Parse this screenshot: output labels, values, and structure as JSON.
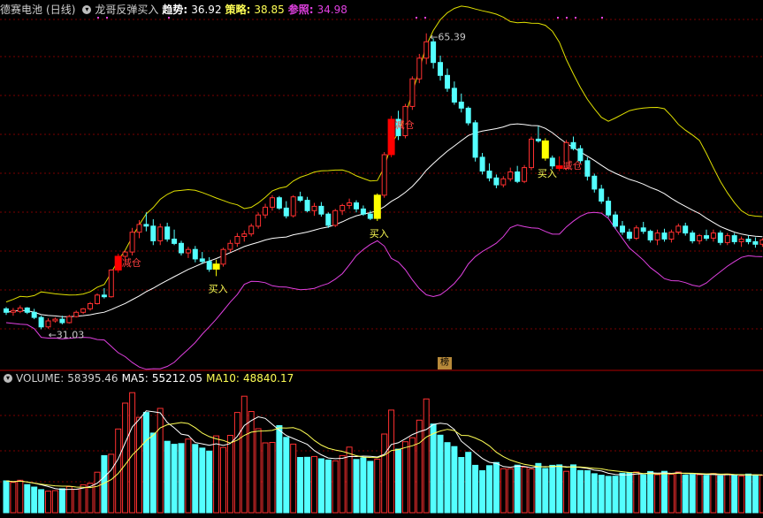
{
  "header": {
    "stock_name": "德赛电池",
    "period": "(日线)",
    "indicator_name": "龙哥反弹买入",
    "trend_label": "趋势:",
    "trend_value": "36.92",
    "strategy_label": "策略:",
    "strategy_value": "38.85",
    "ref_label": "参照:",
    "ref_value": "34.98"
  },
  "volume_header": {
    "vol_label": "VOLUME:",
    "vol_value": "58395.46",
    "ma5_label": "MA5:",
    "ma5_value": "55212.05",
    "ma10_label": "MA10:",
    "ma10_value": "48840.17"
  },
  "divider_tag": "榜",
  "colors": {
    "background": "#000000",
    "up": "#ff3030",
    "down": "#54ffff",
    "upper_band": "#e0e000",
    "mid_line": "#ffffff",
    "lower_band": "#e040e0",
    "grid": "#7a0000",
    "buy_bar": "#ffff00",
    "sell_bar": "#ff0000"
  },
  "chart_data": {
    "type": "candlestick",
    "price_min": 31.03,
    "price_max": 65.39,
    "labels": {
      "low": "31.03",
      "high": "65.39"
    },
    "signals": {
      "buy_text": "买入",
      "sell_text": "减仓",
      "buy_indices": [
        30,
        53,
        77
      ],
      "sell_indices": [
        16,
        55,
        79
      ]
    },
    "candles": [
      [
        33.4,
        33.6,
        32.7,
        33.0
      ],
      [
        33.0,
        33.5,
        32.6,
        33.2
      ],
      [
        33.1,
        33.8,
        32.9,
        33.5
      ],
      [
        33.5,
        33.6,
        32.8,
        33.0
      ],
      [
        33.0,
        33.4,
        32.2,
        32.4
      ],
      [
        32.4,
        32.6,
        31.03,
        31.3
      ],
      [
        31.3,
        32.3,
        31.1,
        32.0
      ],
      [
        32.0,
        32.4,
        31.8,
        32.2
      ],
      [
        32.2,
        32.6,
        31.6,
        31.8
      ],
      [
        31.8,
        32.7,
        31.7,
        32.5
      ],
      [
        32.5,
        33.2,
        32.4,
        33.0
      ],
      [
        33.0,
        33.5,
        32.8,
        33.4
      ],
      [
        33.4,
        34.2,
        33.2,
        34.0
      ],
      [
        34.0,
        35.2,
        33.9,
        35.0
      ],
      [
        35.0,
        35.8,
        34.6,
        34.8
      ],
      [
        34.8,
        38.0,
        34.7,
        37.9
      ],
      [
        37.9,
        39.8,
        37.6,
        39.5
      ],
      [
        39.5,
        40.2,
        38.9,
        40.0
      ],
      [
        40.0,
        42.8,
        39.6,
        42.3
      ],
      [
        42.3,
        43.7,
        41.6,
        43.2
      ],
      [
        43.2,
        44.6,
        42.4,
        43.0
      ],
      [
        43.0,
        43.8,
        40.8,
        41.3
      ],
      [
        41.3,
        43.3,
        40.8,
        42.9
      ],
      [
        42.9,
        43.4,
        41.2,
        41.5
      ],
      [
        41.5,
        42.6,
        40.8,
        41.0
      ],
      [
        41.0,
        41.3,
        39.6,
        39.9
      ],
      [
        39.9,
        40.6,
        39.3,
        40.3
      ],
      [
        40.3,
        40.7,
        38.8,
        39.2
      ],
      [
        39.2,
        40.0,
        38.6,
        38.9
      ],
      [
        38.9,
        39.4,
        37.7,
        38.0
      ],
      [
        38.0,
        39.1,
        37.2,
        38.6
      ],
      [
        38.6,
        40.5,
        38.3,
        40.3
      ],
      [
        40.3,
        41.4,
        40.0,
        41.0
      ],
      [
        41.0,
        42.2,
        40.6,
        41.8
      ],
      [
        41.8,
        42.5,
        41.2,
        42.1
      ],
      [
        42.1,
        43.3,
        41.8,
        43.0
      ],
      [
        43.0,
        44.6,
        42.7,
        44.3
      ],
      [
        44.3,
        45.6,
        43.9,
        45.2
      ],
      [
        45.2,
        46.6,
        44.8,
        46.3
      ],
      [
        46.3,
        46.5,
        44.9,
        45.1
      ],
      [
        45.1,
        45.9,
        43.9,
        44.2
      ],
      [
        44.2,
        46.6,
        44.0,
        46.4
      ],
      [
        46.4,
        47.0,
        45.8,
        46.0
      ],
      [
        46.0,
        46.4,
        44.6,
        44.8
      ],
      [
        44.8,
        45.7,
        44.2,
        45.3
      ],
      [
        45.3,
        45.8,
        44.1,
        44.4
      ],
      [
        44.4,
        44.6,
        42.8,
        43.1
      ],
      [
        43.1,
        45.0,
        42.9,
        44.8
      ],
      [
        44.8,
        45.6,
        44.3,
        45.4
      ],
      [
        45.4,
        46.2,
        45.0,
        45.7
      ],
      [
        45.7,
        46.0,
        44.6,
        45.0
      ],
      [
        45.0,
        45.4,
        44.2,
        44.4
      ],
      [
        44.4,
        44.8,
        43.7,
        43.9
      ],
      [
        43.9,
        46.8,
        43.6,
        46.6
      ],
      [
        46.6,
        51.6,
        46.3,
        51.3
      ],
      [
        51.3,
        55.8,
        51.0,
        55.4
      ],
      [
        55.4,
        56.4,
        53.0,
        53.5
      ],
      [
        53.5,
        57.2,
        53.2,
        56.9
      ],
      [
        56.9,
        60.4,
        56.5,
        60.1
      ],
      [
        60.1,
        63.0,
        59.6,
        62.5
      ],
      [
        62.5,
        65.39,
        61.8,
        64.4
      ],
      [
        64.4,
        64.8,
        61.3,
        62.0
      ],
      [
        62.0,
        62.8,
        59.9,
        60.5
      ],
      [
        60.5,
        61.3,
        58.6,
        59.0
      ],
      [
        59.0,
        59.8,
        57.1,
        57.4
      ],
      [
        57.4,
        58.4,
        56.2,
        56.7
      ],
      [
        56.7,
        56.9,
        54.7,
        55.0
      ],
      [
        55.0,
        55.3,
        50.5,
        51.0
      ],
      [
        51.0,
        51.5,
        49.0,
        49.4
      ],
      [
        49.4,
        50.3,
        48.2,
        48.6
      ],
      [
        48.6,
        49.0,
        47.4,
        47.8
      ],
      [
        47.8,
        48.8,
        47.5,
        48.5
      ],
      [
        48.5,
        49.8,
        48.2,
        49.3
      ],
      [
        49.3,
        50.0,
        48.0,
        48.2
      ],
      [
        48.2,
        50.1,
        48.0,
        49.8
      ],
      [
        49.8,
        53.4,
        49.5,
        53.1
      ],
      [
        53.1,
        54.6,
        52.7,
        52.9
      ],
      [
        52.9,
        53.2,
        50.6,
        50.9
      ],
      [
        50.9,
        51.2,
        49.6,
        50.0
      ],
      [
        50.0,
        51.1,
        49.4,
        49.7
      ],
      [
        49.7,
        53.0,
        49.5,
        52.7
      ],
      [
        52.7,
        53.4,
        51.8,
        52.0
      ],
      [
        52.0,
        52.4,
        50.3,
        50.6
      ],
      [
        50.6,
        51.0,
        48.3,
        48.8
      ],
      [
        48.8,
        49.1,
        46.9,
        47.3
      ],
      [
        47.3,
        47.8,
        45.6,
        45.9
      ],
      [
        45.9,
        46.4,
        44.0,
        44.3
      ],
      [
        44.3,
        44.7,
        42.7,
        43.0
      ],
      [
        43.0,
        43.6,
        42.0,
        42.3
      ],
      [
        42.3,
        42.7,
        41.3,
        41.6
      ],
      [
        41.6,
        43.1,
        41.4,
        42.8
      ],
      [
        42.8,
        43.5,
        42.1,
        42.4
      ],
      [
        42.4,
        42.6,
        41.1,
        41.4
      ],
      [
        41.4,
        42.6,
        40.8,
        42.2
      ],
      [
        42.2,
        42.7,
        41.2,
        41.5
      ],
      [
        41.5,
        42.6,
        41.1,
        42.3
      ],
      [
        42.3,
        43.3,
        42.0,
        43.0
      ],
      [
        43.0,
        43.4,
        41.9,
        42.2
      ],
      [
        42.2,
        42.5,
        41.0,
        41.3
      ],
      [
        41.3,
        42.1,
        40.9,
        41.9
      ],
      [
        41.9,
        42.6,
        41.3,
        41.6
      ],
      [
        41.6,
        42.6,
        41.2,
        42.2
      ],
      [
        42.2,
        42.5,
        40.8,
        41.1
      ],
      [
        41.1,
        42.2,
        40.8,
        41.9
      ],
      [
        41.9,
        42.2,
        40.9,
        41.2
      ],
      [
        41.2,
        41.8,
        40.6,
        41.5
      ],
      [
        41.5,
        41.9,
        40.9,
        41.2
      ],
      [
        41.2,
        41.7,
        40.5,
        40.9
      ],
      [
        40.9,
        41.6,
        40.6,
        41.4
      ]
    ],
    "volume": [
      1.9,
      1.81,
      1.94,
      1.68,
      1.53,
      1.38,
      1.29,
      1.32,
      1.43,
      1.56,
      1.4,
      1.67,
      1.76,
      2.42,
      3.41,
      3.49,
      5.0,
      6.55,
      7.17,
      5.7,
      5.99,
      4.76,
      6.23,
      4.27,
      4.09,
      4.13,
      4.4,
      4.08,
      3.86,
      3.68,
      4.59,
      3.9,
      4.62,
      5.99,
      6.96,
      6.05,
      5.02,
      4.17,
      4.2,
      5.2,
      4.5,
      4.1,
      3.3,
      3.31,
      3.36,
      3.22,
      3.15,
      3.1,
      3.41,
      3.92,
      3.18,
      3.28,
      3.07,
      3.2,
      4.7,
      6.13,
      3.8,
      4.24,
      4.48,
      5.53,
      6.8,
      5.3,
      4.63,
      4.19,
      3.95,
      3.3,
      3.61,
      2.83,
      2.51,
      2.81,
      3.0,
      2.63,
      2.63,
      2.84,
      2.72,
      2.61,
      2.94,
      2.64,
      2.83,
      2.86,
      2.47,
      2.86,
      2.52,
      2.51,
      2.33,
      2.24,
      2.17,
      2.18,
      2.36,
      2.39,
      2.43,
      2.26,
      2.46,
      2.27,
      2.47,
      2.29,
      2.43,
      2.25,
      2.28,
      2.27,
      2.23,
      2.34,
      2.2,
      2.31,
      2.27,
      2.19,
      2.31,
      2.24,
      2.23
    ]
  }
}
